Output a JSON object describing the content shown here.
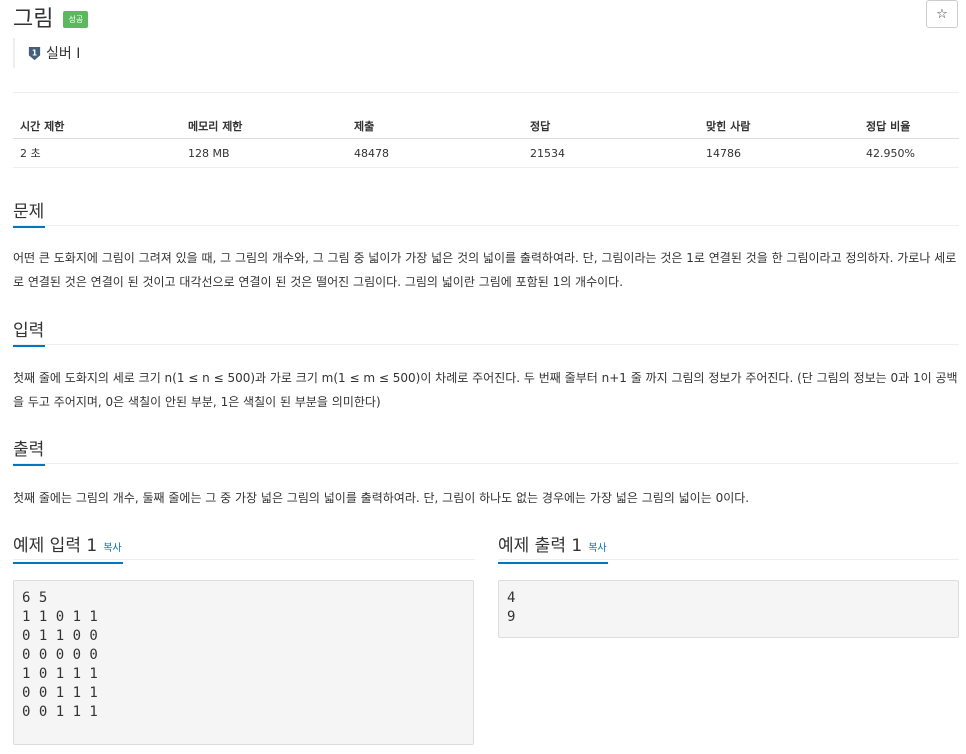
{
  "problem": {
    "title": "그림",
    "badge": "성공",
    "tier": "실버 I",
    "star": "☆"
  },
  "stats": {
    "headers": [
      "시간 제한",
      "메모리 제한",
      "제출",
      "정답",
      "맞힌 사람",
      "정답 비율"
    ],
    "values": [
      "2 초",
      "128 MB",
      "48478",
      "21534",
      "14786",
      "42.950%"
    ]
  },
  "sections": {
    "problem": {
      "title": "문제",
      "body": "어떤 큰 도화지에 그림이 그려져 있을 때, 그 그림의 개수와, 그 그림 중 넓이가 가장 넓은 것의 넓이를 출력하여라. 단, 그림이라는 것은 1로 연결된 것을 한 그림이라고 정의하자. 가로나 세로로 연결된 것은 연결이 된 것이고 대각선으로 연결이 된 것은 떨어진 그림이다. 그림의 넓이란 그림에 포함된 1의 개수이다."
    },
    "input": {
      "title": "입력",
      "body": "첫째 줄에 도화지의 세로 크기 n(1 ≤ n ≤ 500)과 가로 크기 m(1 ≤ m ≤ 500)이 차례로 주어진다. 두 번째 줄부터 n+1 줄 까지 그림의 정보가 주어진다. (단 그림의 정보는 0과 1이 공백을 두고 주어지며, 0은 색칠이 안된 부분, 1은 색칠이 된 부분을 의미한다)"
    },
    "output": {
      "title": "출력",
      "body": "첫째 줄에는 그림의 개수, 둘째 줄에는 그 중 가장 넓은 그림의 넓이를 출력하여라. 단, 그림이 하나도 없는 경우에는 가장 넓은 그림의 넓이는 0이다."
    }
  },
  "examples": {
    "input": {
      "title": "예제 입력 1",
      "copy": "복사",
      "content": "6 5\n1 1 0 1 1\n0 1 1 0 0\n0 0 0 0 0\n1 0 1 1 1\n0 0 1 1 1\n0 0 1 1 1"
    },
    "output": {
      "title": "예제 출력 1",
      "copy": "복사",
      "content": "4\n9"
    }
  },
  "colors": {
    "accent": "#0076c0",
    "badge": "#5cb85c",
    "tier": "#435f7a"
  }
}
